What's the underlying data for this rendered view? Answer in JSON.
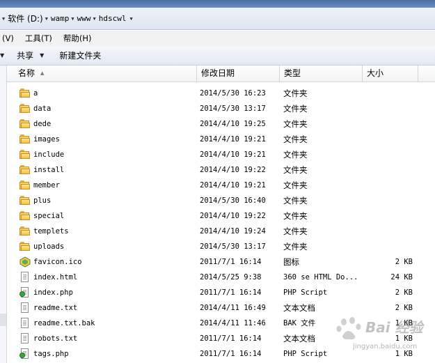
{
  "breadcrumbs": [
    {
      "label": "软件 (D:)"
    },
    {
      "label": "wamp"
    },
    {
      "label": "www"
    },
    {
      "label": "hdscwl"
    }
  ],
  "menu": [
    "(V)",
    "工具(T)",
    "帮助(H)"
  ],
  "toolbar": {
    "share_label": "共享",
    "new_folder_label": "新建文件夹"
  },
  "columns": {
    "name": "名称",
    "date": "修改日期",
    "type": "类型",
    "size": "大小"
  },
  "files": [
    {
      "name": "a",
      "date": "2014/5/30 16:23",
      "type": "文件夹",
      "size": "",
      "icon": "folder-icon"
    },
    {
      "name": "data",
      "date": "2014/5/30 13:17",
      "type": "文件夹",
      "size": "",
      "icon": "folder-icon"
    },
    {
      "name": "dede",
      "date": "2014/4/10 19:25",
      "type": "文件夹",
      "size": "",
      "icon": "folder-icon"
    },
    {
      "name": "images",
      "date": "2014/4/10 19:21",
      "type": "文件夹",
      "size": "",
      "icon": "folder-icon"
    },
    {
      "name": "include",
      "date": "2014/4/10 19:21",
      "type": "文件夹",
      "size": "",
      "icon": "folder-icon"
    },
    {
      "name": "install",
      "date": "2014/4/10 19:22",
      "type": "文件夹",
      "size": "",
      "icon": "folder-icon"
    },
    {
      "name": "member",
      "date": "2014/4/10 19:21",
      "type": "文件夹",
      "size": "",
      "icon": "folder-icon"
    },
    {
      "name": "plus",
      "date": "2014/5/30 16:40",
      "type": "文件夹",
      "size": "",
      "icon": "folder-icon"
    },
    {
      "name": "special",
      "date": "2014/4/10 19:22",
      "type": "文件夹",
      "size": "",
      "icon": "folder-icon"
    },
    {
      "name": "templets",
      "date": "2014/4/10 19:24",
      "type": "文件夹",
      "size": "",
      "icon": "folder-icon"
    },
    {
      "name": "uploads",
      "date": "2014/5/30 13:17",
      "type": "文件夹",
      "size": "",
      "icon": "folder-icon"
    },
    {
      "name": "favicon.ico",
      "date": "2011/7/1 16:14",
      "type": "图标",
      "size": "2 KB",
      "icon": "ico-file-icon"
    },
    {
      "name": "index.html",
      "date": "2014/5/25 9:38",
      "type": "360 se HTML Do...",
      "size": "24 KB",
      "icon": "html-file-icon"
    },
    {
      "name": "index.php",
      "date": "2011/7/1 16:14",
      "type": "PHP Script",
      "size": "2 KB",
      "icon": "php-file-icon"
    },
    {
      "name": "readme.txt",
      "date": "2014/4/11 16:49",
      "type": "文本文档",
      "size": "2 KB",
      "icon": "text-file-icon"
    },
    {
      "name": "readme.txt.bak",
      "date": "2014/4/11 11:46",
      "type": "BAK 文件",
      "size": "1 KB",
      "icon": "bak-file-icon"
    },
    {
      "name": "robots.txt",
      "date": "2011/7/1 16:14",
      "type": "文本文档",
      "size": "1 KB",
      "icon": "text-file-icon"
    },
    {
      "name": "tags.php",
      "date": "2011/7/1 16:14",
      "type": "PHP Script",
      "size": "1 KB",
      "icon": "php-file-icon"
    }
  ],
  "watermark": {
    "text": "Bai 经验",
    "url": "jingyan.baidu.com"
  }
}
